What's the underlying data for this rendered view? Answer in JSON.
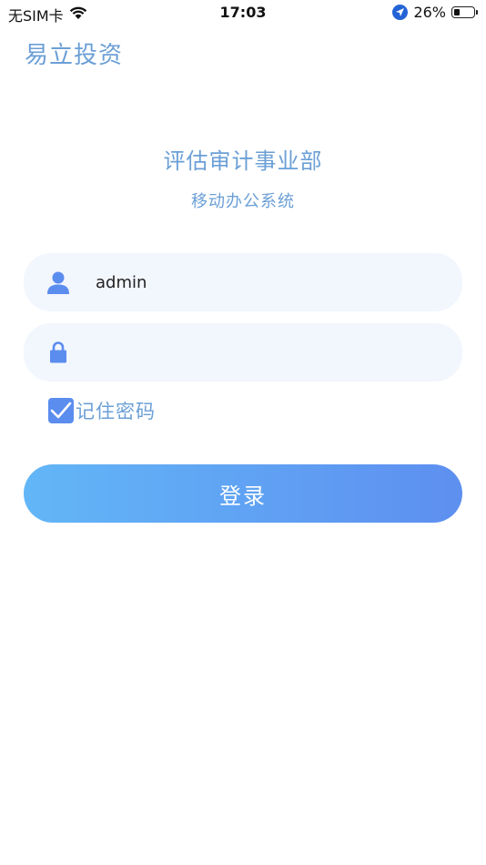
{
  "status_bar": {
    "carrier": "无SIM卡",
    "time": "17:03",
    "battery": "26%",
    "battery_level": 0.26
  },
  "brand": "易立投资",
  "title": "评估审计事业部",
  "subtitle": "移动办公系统",
  "username": {
    "value": "admin",
    "icon": "user-icon"
  },
  "password": {
    "value": "",
    "icon": "lock-icon"
  },
  "remember": {
    "label": "记住密码",
    "checked": true
  },
  "login_label": "登录",
  "colors": {
    "accent": "#5b8def",
    "text_accent": "#6b9fd6",
    "field_bg": "#f2f6fd",
    "button_gradient_start": "#62b6f7",
    "button_gradient_end": "#5e8ff0"
  }
}
